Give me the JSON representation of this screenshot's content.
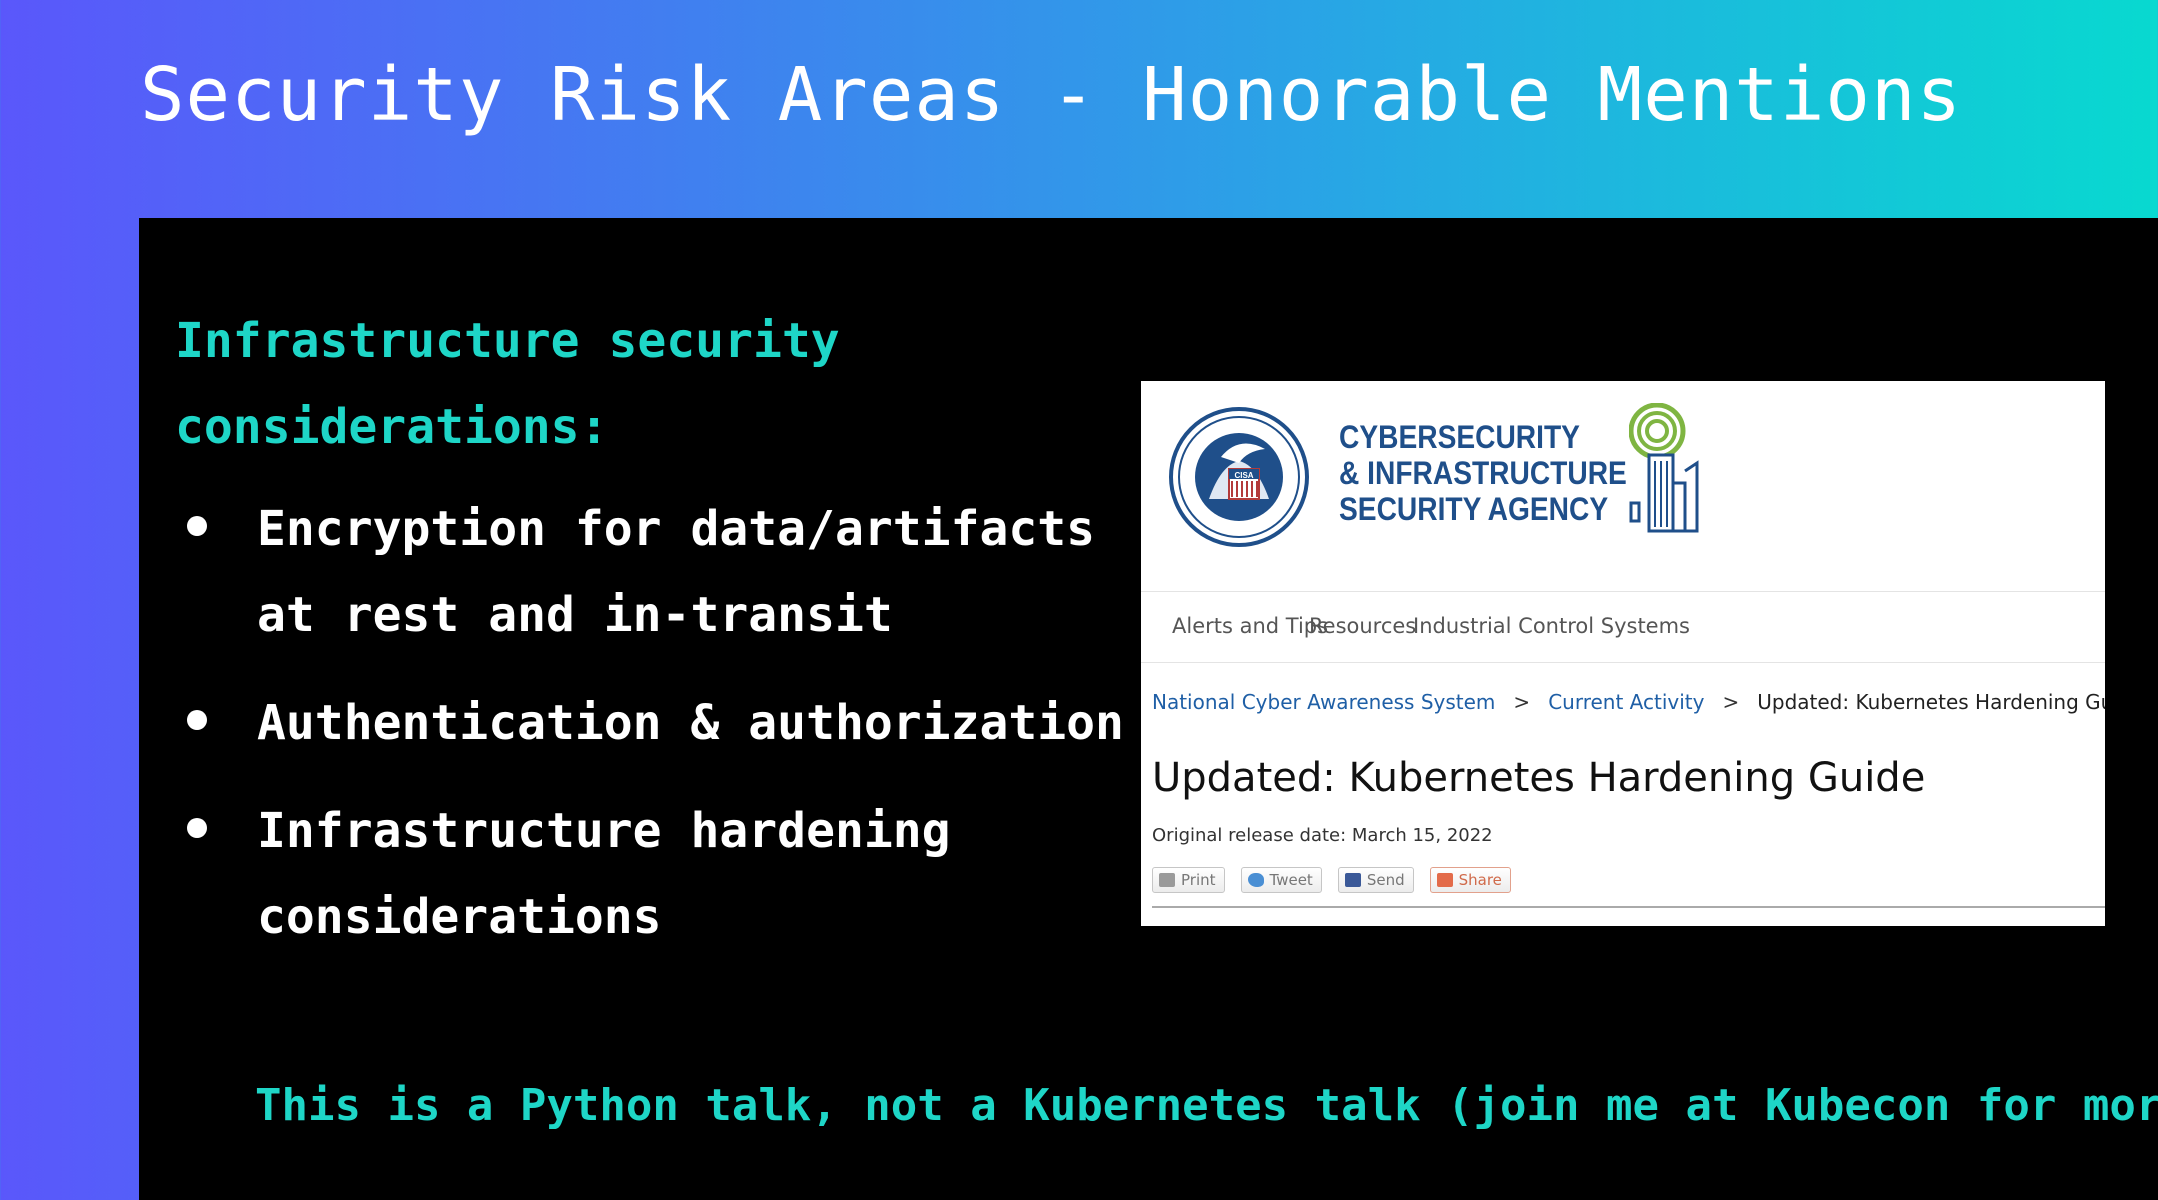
{
  "slide": {
    "title": "Security Risk Areas - Honorable Mentions",
    "section_heading": "Infrastructure security\nconsiderations:",
    "bullets": [
      "Encryption for data/artifacts\nat rest and in-transit",
      "Authentication & authorization",
      "Infrastructure hardening\nconsiderations"
    ],
    "footer_note": "This is a Python talk, not a Kubernetes talk (join me at Kubecon for more)"
  },
  "cisa_page": {
    "seal_text": "CISA",
    "wordmark": [
      "CYBERSECURITY",
      "& INFRASTRUCTURE",
      "SECURITY AGENCY"
    ],
    "nav": [
      "Alerts and Tips",
      "Resources",
      "Industrial Control Systems"
    ],
    "breadcrumb": {
      "items": [
        "National Cyber Awareness System",
        "Current Activity"
      ],
      "separator": ">",
      "current": "Updated: Kubernetes Hardening Guide"
    },
    "article_title": "Updated: Kubernetes Hardening Guide",
    "release_date": "Original release date: March 15, 2022",
    "share_buttons": [
      "Print",
      "Tweet",
      "Send",
      "Share"
    ]
  },
  "colors": {
    "accent_teal": "#1ed6c7",
    "panel": "#000000",
    "gradient_start": "#5a57fb",
    "gradient_end": "#08d9d0",
    "cisa_blue": "#1f4f8a",
    "cisa_green": "#7fb542"
  }
}
